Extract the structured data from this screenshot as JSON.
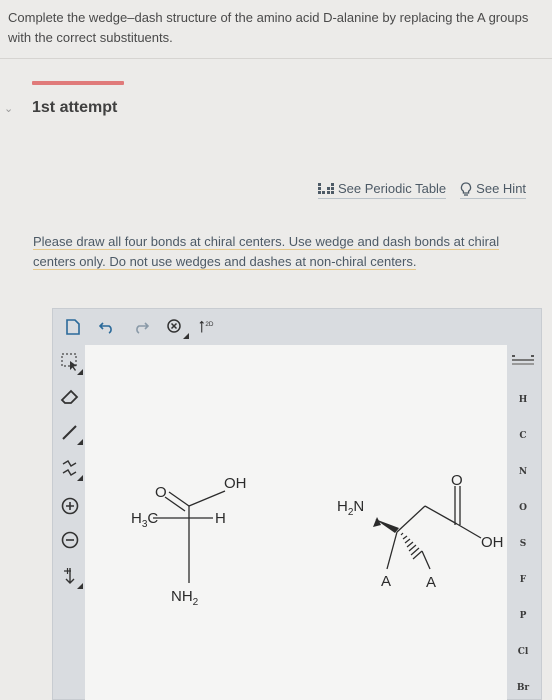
{
  "question": {
    "text": "Complete the wedge–dash structure of the amino acid D-alanine by replacing the A groups with the correct substituents."
  },
  "attempt": {
    "title": "1st attempt"
  },
  "links": {
    "periodic_table": "See Periodic Table",
    "hint": "See Hint"
  },
  "instruction": {
    "text": "Please draw all four bonds at chiral centers. Use wedge and dash bonds at chiral centers only. Do not use wedges and dashes at non-chiral centers."
  },
  "toolbar": {
    "template_label": "2D"
  },
  "left_tools": {
    "charge_plus": "+",
    "charge_minus": "−"
  },
  "atoms": [
    "H",
    "C",
    "N",
    "O",
    "S",
    "F",
    "P",
    "Cl",
    "Br"
  ],
  "molecule_left": {
    "o_label": "O",
    "oh_label": "OH",
    "ch3_main": "H",
    "ch3_sub": "3",
    "ch3_tail": "C",
    "h_label": "H",
    "nh2_main": "NH",
    "nh2_sub": "2"
  },
  "molecule_right": {
    "h2n_main": "H",
    "h2n_sub": "2",
    "h2n_tail": "N",
    "o_label": "O",
    "oh_label": "OH",
    "a1_label": "A",
    "a2_label": "A"
  }
}
